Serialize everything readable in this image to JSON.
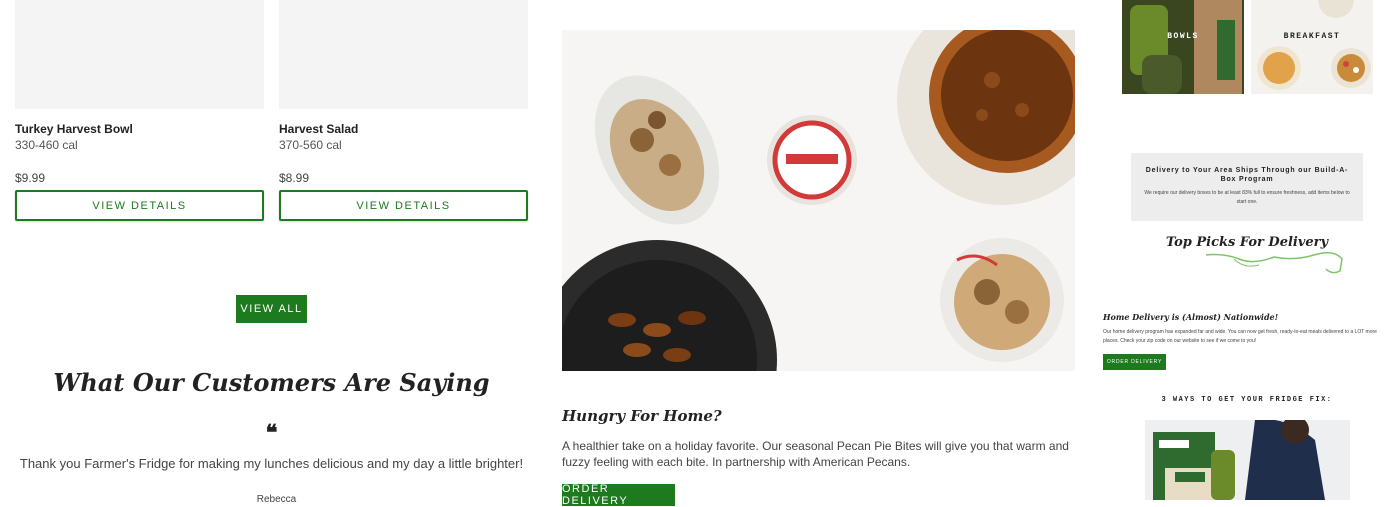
{
  "products": [
    {
      "name": "Turkey Harvest Bowl",
      "calories": "330-460 cal",
      "price": "$9.99",
      "button": "VIEW DETAILS"
    },
    {
      "name": "Harvest Salad",
      "calories": "370-560 cal",
      "price": "$8.99",
      "button": "VIEW DETAILS"
    }
  ],
  "view_all_label": "VIEW ALL",
  "testimonials": {
    "title": "What Our Customers Are Saying",
    "quote_mark": "❝",
    "quote": "Thank you Farmer's Fridge for making my lunches delicious and my day a little brighter!",
    "author": "Rebecca"
  },
  "promo": {
    "title": "Hungry For Home?",
    "body": "A healthier take on a holiday favorite. Our seasonal Pecan Pie Bites will give you that warm and fuzzy feeling with each bite. In partnership with American Pecans.",
    "cta": "ORDER DELIVERY"
  },
  "side": {
    "thumbs": [
      {
        "label": "BOWLS"
      },
      {
        "label": "BREAKFAST"
      }
    ],
    "delivery_box": {
      "title": "Delivery to Your Area Ships Through our Build-A-Box Program",
      "text": "We require our delivery boxes to be at least 83% full to ensure freshness, add items below to start one."
    },
    "top_picks": "Top Picks For Delivery",
    "home_delivery": {
      "title": "Home Delivery is (Almost) Nationwide!",
      "text": "Our home delivery program has expanded far and wide. You can now get fresh, ready-to-eat meals delivered to a LOT more places. Check your zip code on our website to see if we come to you!",
      "cta": "ORDER DELIVERY"
    },
    "ways_title": "3 WAYS TO GET YOUR FRIDGE FIX:"
  },
  "colors": {
    "brand_green": "#1e7a1e",
    "light_green": "#7fc36a"
  }
}
